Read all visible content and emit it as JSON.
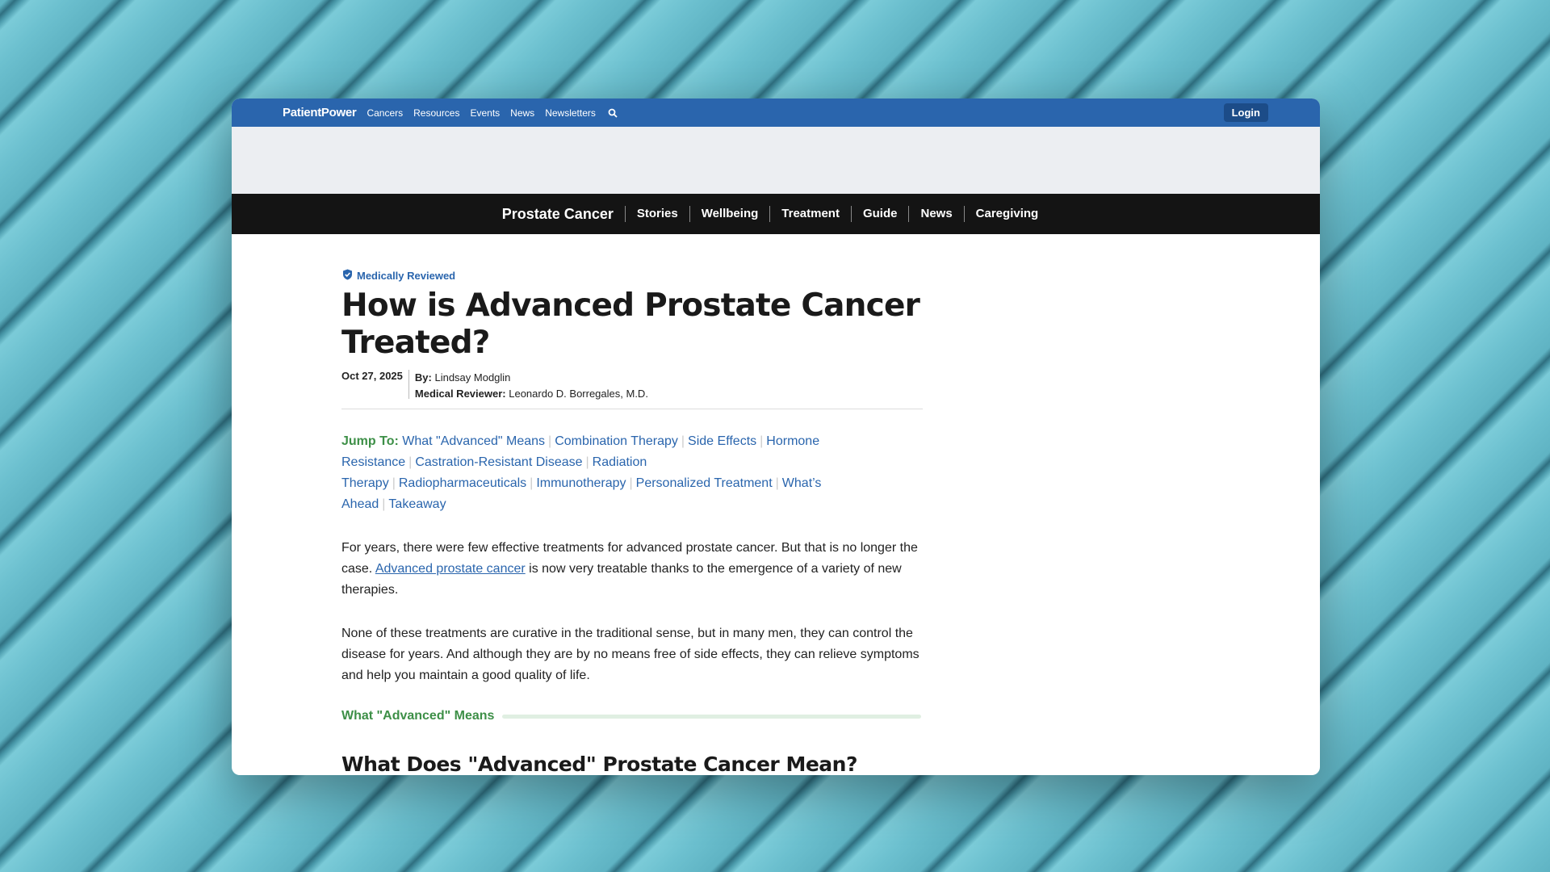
{
  "topbar": {
    "logo": "PatientPower",
    "nav": [
      "Cancers",
      "Resources",
      "Events",
      "News",
      "Newsletters"
    ],
    "login": "Login"
  },
  "catnav": {
    "brand": "Prostate Cancer",
    "items": [
      "Stories",
      "Wellbeing",
      "Treatment",
      "Guide",
      "News",
      "Caregiving"
    ]
  },
  "article": {
    "badge": "Medically Reviewed",
    "title": "How is Advanced Prostate Cancer Treated?",
    "date": "Oct 27, 2025",
    "by_label": "By:",
    "author": "Lindsay Modglin",
    "reviewer_label": "Medical Reviewer:",
    "reviewer": "Leonardo D. Borregales, M.D.",
    "jump_label": "Jump To:",
    "jump_links": [
      "What \"Advanced\" Means",
      "Combination Therapy",
      "Side Effects",
      "Hormone Resistance",
      "Castration-Resistant Disease",
      "Radiation Therapy",
      "Radiopharmaceuticals",
      "Immunotherapy",
      "Personalized Treatment",
      "What’s Ahead",
      "Takeaway"
    ],
    "p1_before": "For years, there were few effective treatments for advanced prostate cancer. But that is no longer the case.",
    "p1_link": "Advanced prostate cancer",
    "p1_after": "is now very treatable thanks to the emergence of a variety of new therapies.",
    "p2": "None of these treatments are curative in the traditional sense, but in many men, they can control the disease for years. And although they are by no means free of side effects, they can relieve symptoms and help you maintain a good quality of life.",
    "section_label": "What \"Advanced\" Means",
    "h2": "What Does \"Advanced\" Prostate Cancer Mean?"
  },
  "colors": {
    "topbar": "#2a65ad",
    "catnav": "#141414",
    "accent_green": "#3d8f47",
    "link": "#2a65ad"
  }
}
